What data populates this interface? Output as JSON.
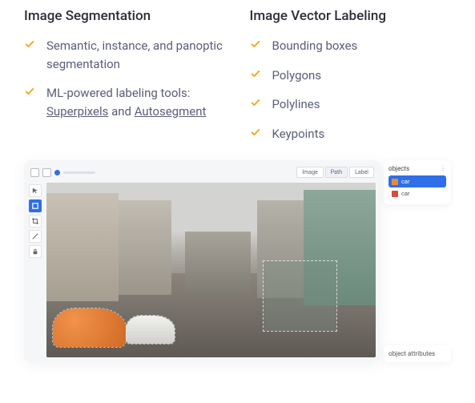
{
  "columns": [
    {
      "title": "Image Segmentation",
      "items": [
        {
          "text": "Semantic, instance, and panoptic segmentation",
          "links": []
        },
        {
          "text": "ML-powered labeling tools: ",
          "links": [
            "Superpixels",
            "Autosegment"
          ],
          "joiner": " and "
        }
      ]
    },
    {
      "title": "Image Vector Labeling",
      "items": [
        {
          "text": "Bounding boxes"
        },
        {
          "text": "Polygons"
        },
        {
          "text": "Polylines"
        },
        {
          "text": "Keypoints"
        }
      ]
    }
  ],
  "editor": {
    "top_tabs": [
      "Image",
      "Path",
      "Label"
    ],
    "active_tab": 1,
    "tools": [
      "pointer",
      "box",
      "crop",
      "pen",
      "lock"
    ],
    "active_tool": 1
  },
  "objects_panel": {
    "title": "objects",
    "items": [
      {
        "color": "orange",
        "label": "car",
        "selected": true
      },
      {
        "color": "red",
        "label": "car",
        "selected": false
      }
    ]
  },
  "attributes_panel": {
    "title": "object attributes"
  },
  "colors": {
    "accent": "#2f6fe8",
    "check": "#f5a623"
  }
}
